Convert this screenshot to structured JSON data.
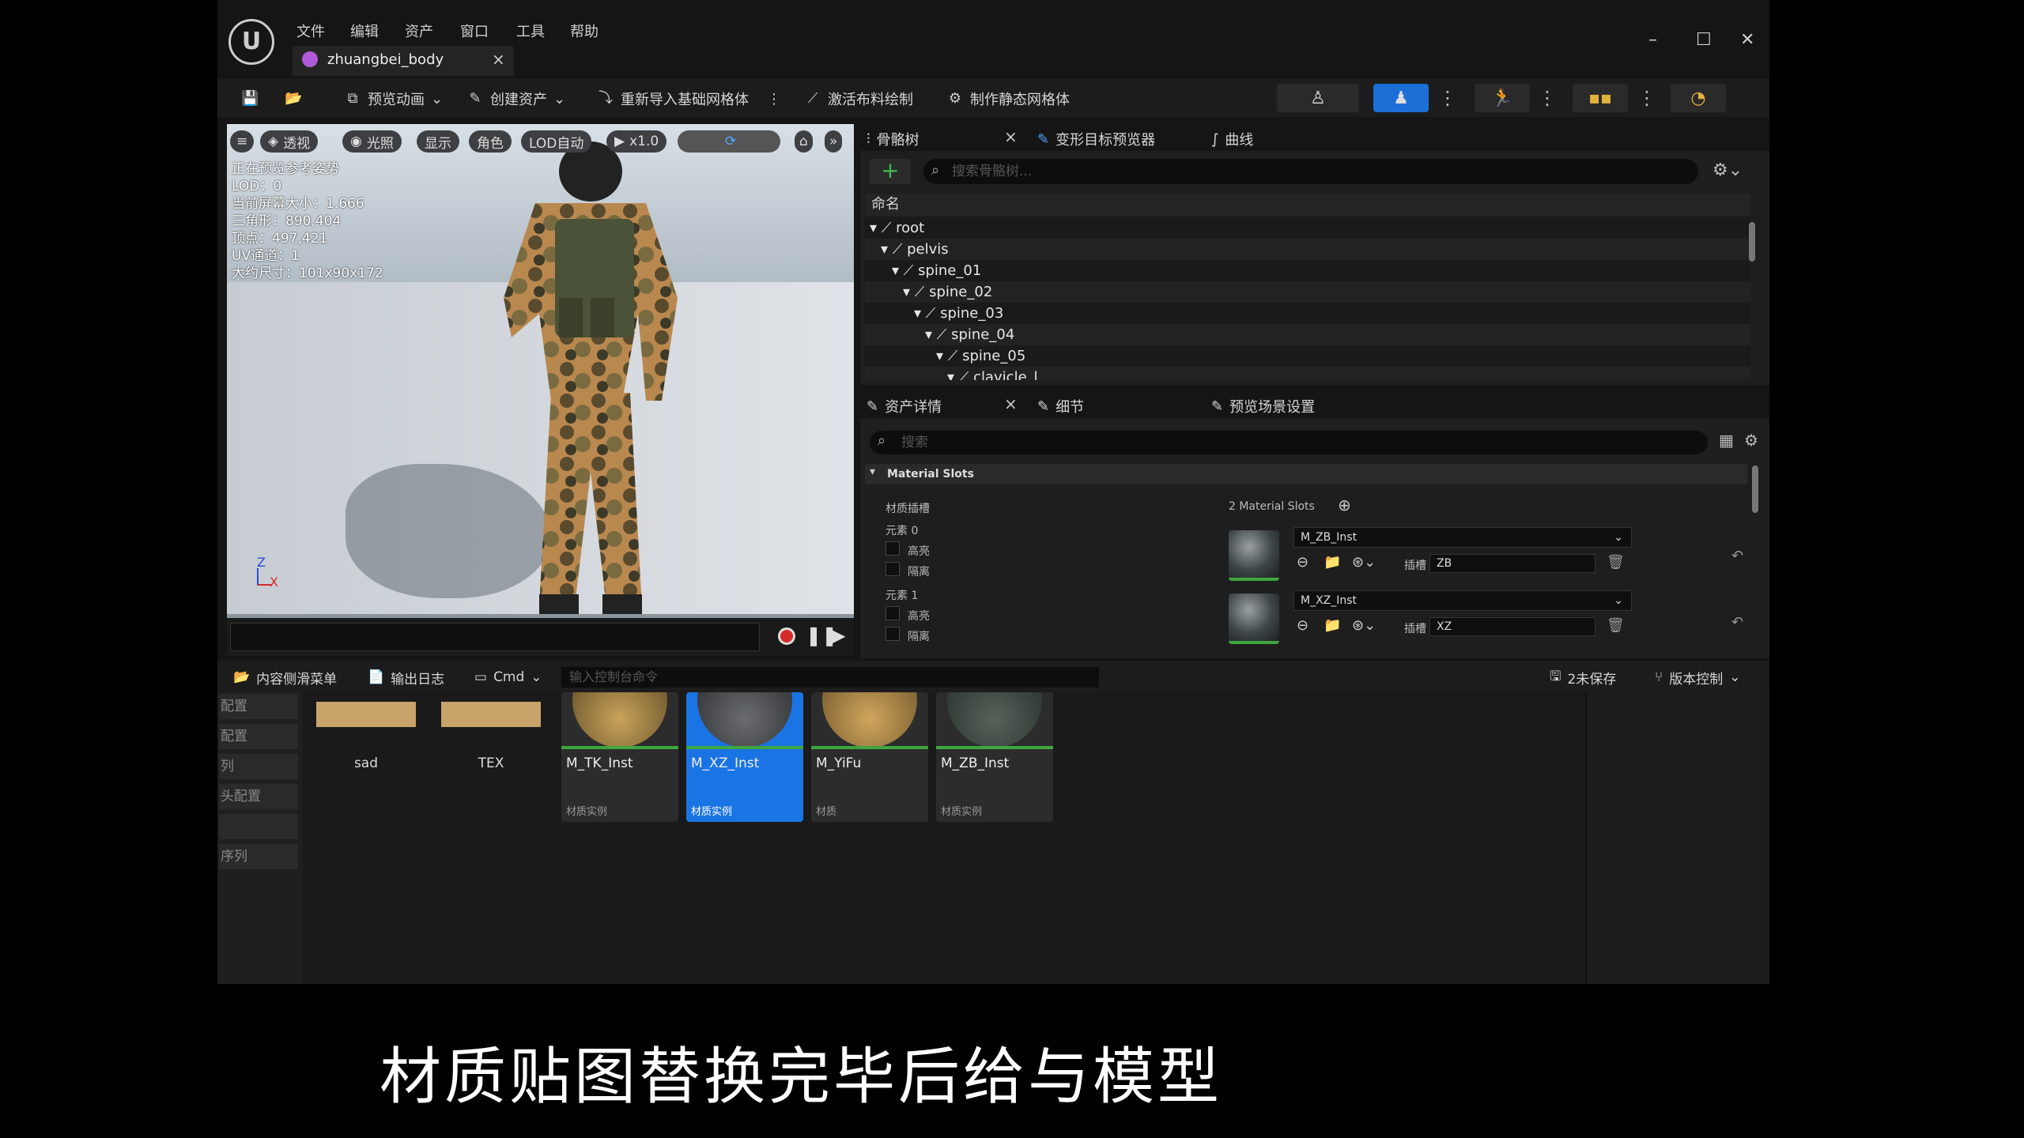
{
  "menu": [
    "文件",
    "编辑",
    "资产",
    "窗口",
    "工具",
    "帮助"
  ],
  "tab": {
    "title": "zhuangbei_body",
    "close": "×"
  },
  "toolbar": {
    "preview_anim": "预览动画",
    "create_asset": "创建资产",
    "reimport": "重新导入基础网格体",
    "cloth_paint": "激活布料绘制",
    "make_static": "制作静态网格体"
  },
  "viewport": {
    "chips": [
      "透视",
      "光照",
      "显示",
      "角色",
      "LOD自动",
      "x1.0"
    ],
    "info": [
      "正在预览参考姿势",
      "LOD：0",
      "当前屏幕大小：1.666",
      "三角形：890,404",
      "顶点：497,421",
      "UV通道：1",
      "大约尺寸：101x90x172"
    ],
    "axis_z": "Z",
    "axis_x": "X"
  },
  "skeleton": {
    "tabs": [
      "骨骼树",
      "变形目标预览器",
      "曲线"
    ],
    "search_placeholder": "搜索骨骼树...",
    "header": "命名",
    "bones": [
      "root",
      "pelvis",
      "spine_01",
      "spine_02",
      "spine_03",
      "spine_04",
      "spine_05",
      "clavicle_l"
    ]
  },
  "details": {
    "tabs": [
      "资产详情",
      "细节",
      "预览场景设置"
    ],
    "search_placeholder": "搜索",
    "section": "Material Slots",
    "slots_label": "材质插槽",
    "slots_count": "2 Material Slots",
    "element0": "元素 0",
    "element1": "元素 1",
    "highlight": "高亮",
    "isolate": "隔离",
    "slot_label": "插槽",
    "mat0": "M_ZB_Inst",
    "mat1": "M_XZ_Inst",
    "slot0": "ZB",
    "slot1": "XZ"
  },
  "bottombar": {
    "content_drawer": "内容侧滑菜单",
    "output_log": "输出日志",
    "cmd": "Cmd",
    "cmd_placeholder": "输入控制台命令",
    "unsaved": "2未保存",
    "version_control": "版本控制"
  },
  "content": {
    "left_items": [
      "配置",
      "配置",
      "列",
      "头配置",
      "",
      "序列"
    ],
    "folders": [
      "sad",
      "TEX"
    ],
    "assets": [
      {
        "name": "M_TK_Inst",
        "type": "材质实例"
      },
      {
        "name": "M_XZ_Inst",
        "type": "材质实例"
      },
      {
        "name": "M_YiFu",
        "type": "材质"
      },
      {
        "name": "M_ZB_Inst",
        "type": "材质实例"
      }
    ]
  },
  "subtitle": "材质贴图替换完毕后给与模型"
}
